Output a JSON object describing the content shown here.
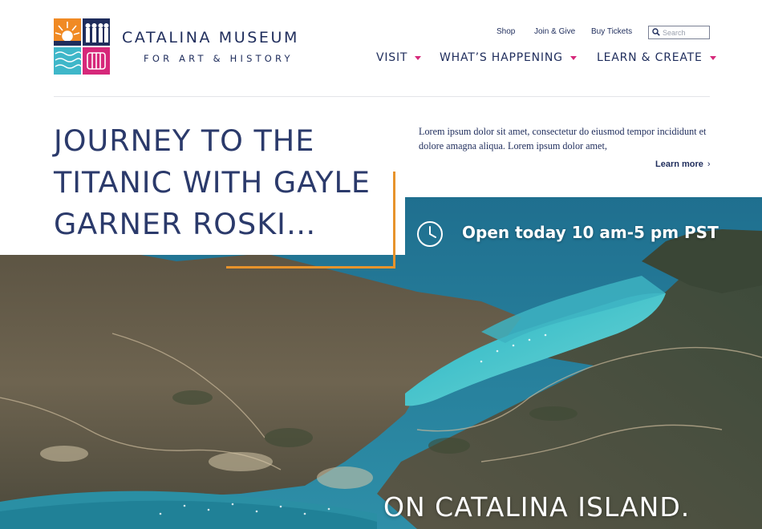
{
  "brand": {
    "title": "CATALINA MUSEUM",
    "subtitle": "FOR ART & HISTORY",
    "logo_colors": [
      "#f08a24",
      "#1f2d5c",
      "#3fb7c9",
      "#d6287a"
    ]
  },
  "utility_nav": {
    "shop": "Shop",
    "join": "Join & Give",
    "tickets": "Buy Tickets",
    "search_placeholder": "Search",
    "search_icon": "search-icon"
  },
  "main_nav": [
    {
      "label": "VISIT"
    },
    {
      "label": "WHAT’S HAPPENING"
    },
    {
      "label": "LEARN & CREATE"
    }
  ],
  "hero": {
    "headline": "JOURNEY TO THE TITANIC WITH GAYLE GARNER ROSKI…",
    "intro": "Lorem ipsum dolor sit amet, consectetur do eiusmod tempor incididunt et dolore amagna aliqua. Lorem ipsum dolor amet,",
    "learn_more": "Learn more",
    "learn_more_chevron": "›",
    "hours_icon": "clock-icon",
    "hours": "Open today 10 am-5 pm PST",
    "tagline": "ON CATALINA ISLAND."
  },
  "colors": {
    "navy": "#1f2d5c",
    "accent_pink": "#d6287a",
    "accent_orange": "#e7932b",
    "ocean": "#27b4c4"
  }
}
